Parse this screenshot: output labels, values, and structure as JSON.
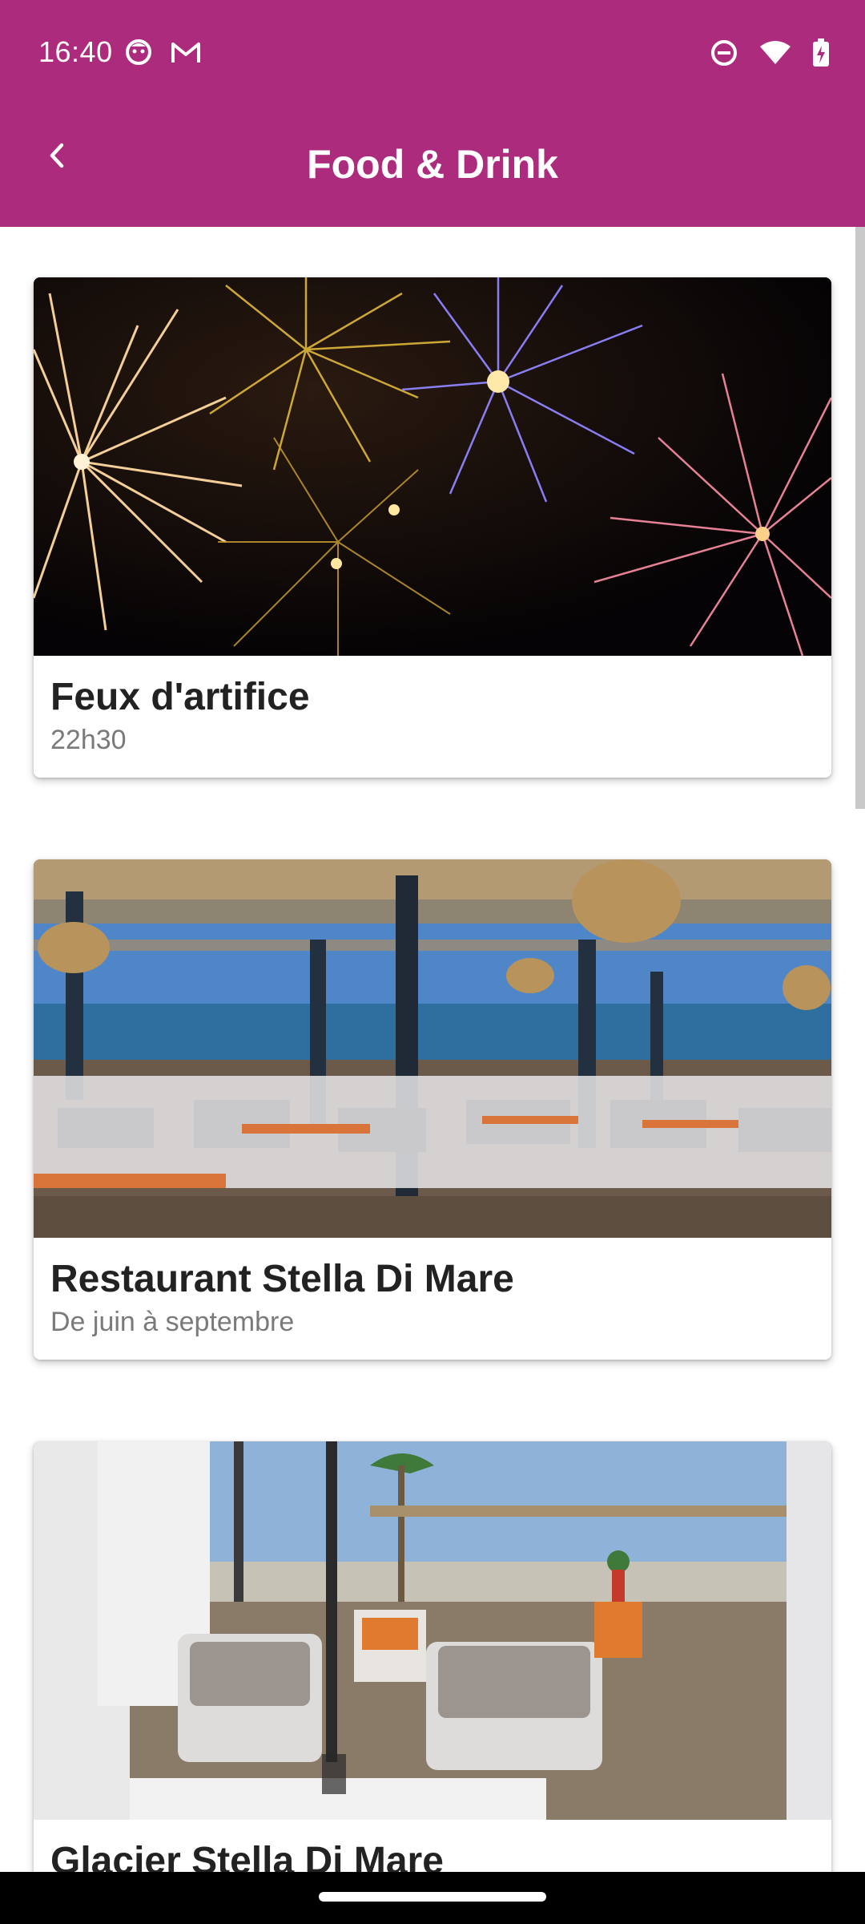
{
  "status_bar": {
    "time": "16:40",
    "left_icons": [
      "face-notification-icon",
      "gmail-icon"
    ],
    "right_icons": [
      "do-not-disturb-icon",
      "wifi-icon",
      "battery-charging-icon"
    ]
  },
  "app_bar": {
    "title": "Food & Drink",
    "back_icon": "chevron-left-icon",
    "color": "#AD2B7C"
  },
  "cards": [
    {
      "title": "Feux d'artifice",
      "subtitle": "22h30",
      "image": "fireworks-photo"
    },
    {
      "title": "Restaurant Stella Di Mare",
      "subtitle": "De juin à septembre",
      "image": "seaside-restaurant-terrace-photo"
    },
    {
      "title": "Glacier Stella Di Mare",
      "subtitle": "",
      "image": "beach-lounge-terrace-photo"
    }
  ]
}
